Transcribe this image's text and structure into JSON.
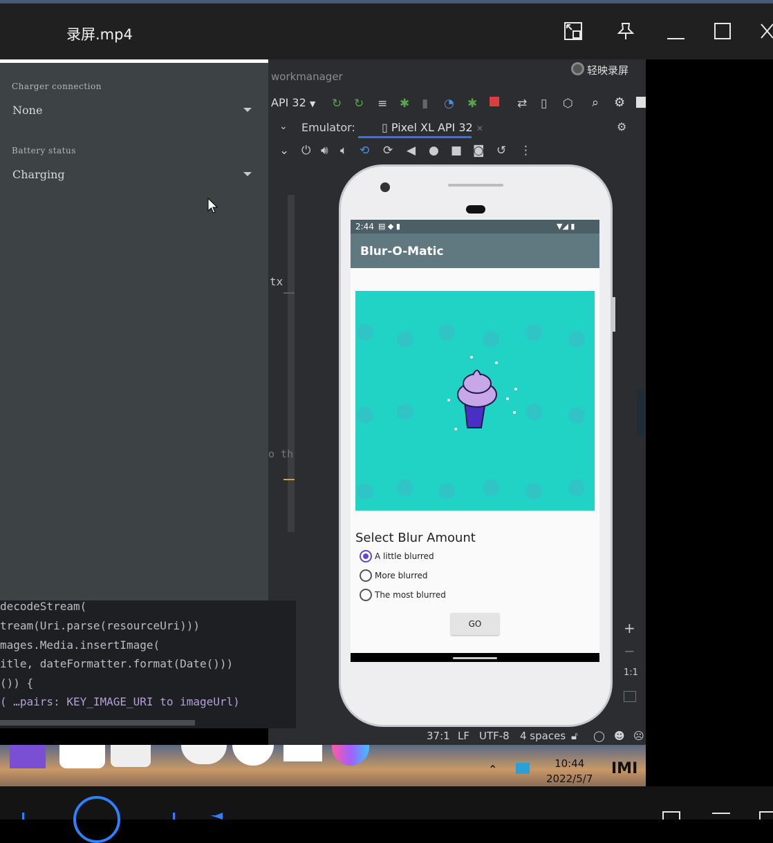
{
  "window": {
    "title": "录屏.mp4",
    "buttons": [
      "picture-in-picture-icon",
      "pin-icon",
      "minimize-icon",
      "maximize-icon",
      "close-icon"
    ]
  },
  "ide": {
    "project": "workmanager",
    "recorder_badge": "轻映录屏",
    "device_selector": "API 32",
    "emulator_label": "Emulator:",
    "device_tab": "Pixel XL API 32",
    "code_fragment_tx": "tx",
    "code_fragment_o": "o th",
    "status": {
      "position": "37:1",
      "line_sep": "LF",
      "encoding": "UTF-8",
      "indent": "4 spaces"
    }
  },
  "settings": {
    "charger_label": "Charger connection",
    "charger_value": "None",
    "battery_label": "Battery status",
    "battery_value": "Charging"
  },
  "code": {
    "lines": [
      "decodeStream(",
      "tream(Uri.parse(resourceUri)))",
      "mages.Media.insertImage(",
      "itle, dateFormatter.format(Date()))",
      "()) {",
      "( …pairs: KEY_IMAGE_URI to imageUrl)"
    ]
  },
  "app": {
    "time": "2:44",
    "title": "Blur-O-Matic",
    "select_label": "Select Blur Amount",
    "options": [
      "A little blurred",
      "More blurred",
      "The most blurred"
    ],
    "selected_index": 0,
    "go_label": "GO"
  },
  "zoom": {
    "plus": "+",
    "minus": "−",
    "ratio": "1:1"
  },
  "taskbar": {
    "time": "10:44",
    "date": "2022/5/7",
    "logo": "IMI"
  },
  "colors": {
    "accent": "#3574f0",
    "app_bar": "#607880",
    "radio_accent": "#6045d6",
    "image_bg": "#20d3c4"
  }
}
